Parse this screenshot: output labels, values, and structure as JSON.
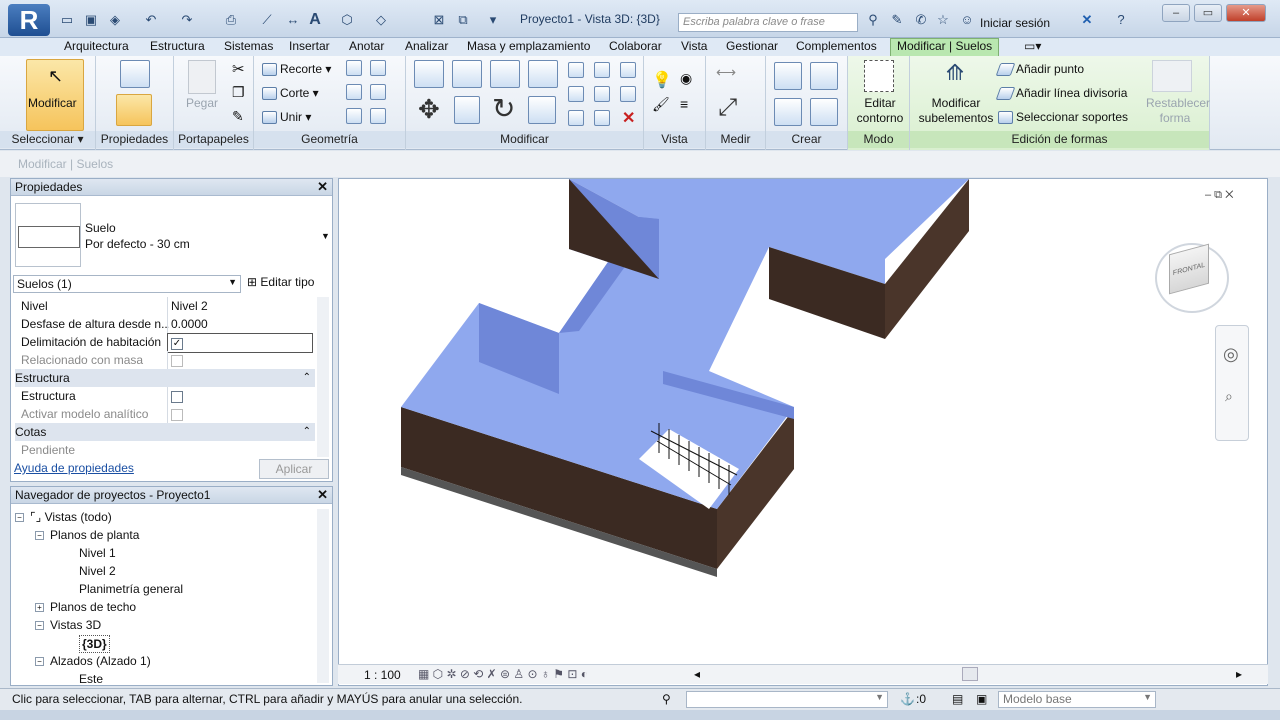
{
  "titlebar": {
    "doc_title": "Proyecto1 - Vista 3D: {3D}",
    "search_placeholder": "Escriba palabra clave o frase",
    "signin": "Iniciar sesión"
  },
  "tabs": [
    "Arquitectura",
    "Estructura",
    "Sistemas",
    "Insertar",
    "Anotar",
    "Analizar",
    "Masa y emplazamiento",
    "Colaborar",
    "Vista",
    "Gestionar",
    "Complementos",
    "Modificar | Suelos"
  ],
  "ribbon": {
    "modificar": "Modificar",
    "seleccionar": "Seleccionar",
    "propiedades": "Propiedades",
    "pegar": "Pegar",
    "portapapeles": "Portapapeles",
    "recorte": "Recorte",
    "corte": "Corte",
    "unir": "Unir",
    "geometria": "Geometría",
    "modificar_panel": "Modificar",
    "vista": "Vista",
    "medir": "Medir",
    "crear": "Crear",
    "editar_contorno": "Editar contorno",
    "modo": "Modo",
    "modificar_subelementos": "Modificar subelementos",
    "anadir_punto": "Añadir punto",
    "anadir_linea": "Añadir línea divisoria",
    "seleccionar_soportes": "Seleccionar soportes",
    "restablecer_forma": "Restablecer forma",
    "edicion_formas": "Edición de formas"
  },
  "optbar": "Modificar | Suelos",
  "properties": {
    "title": "Propiedades",
    "type_name": "Suelo",
    "type_sub": "Por defecto - 30 cm",
    "filter": "Suelos (1)",
    "edit_type": "Editar tipo",
    "rows": [
      {
        "k": "Nivel",
        "v": "Nivel 2"
      },
      {
        "k": "Desfase de altura desde n...",
        "v": "0.0000"
      },
      {
        "k": "Delimitación de habitación",
        "v": "✓"
      },
      {
        "k": "Relacionado con masa",
        "v": ""
      }
    ],
    "group_estructura": "Estructura",
    "estructura": "Estructura",
    "activar": "Activar modelo analítico",
    "group_cotas": "Cotas",
    "pendiente": "Pendiente",
    "help": "Ayuda de propiedades",
    "apply": "Aplicar"
  },
  "navigator": {
    "title": "Navegador de proyectos - Proyecto1",
    "items": [
      "Vistas (todo)",
      "Planos de planta",
      "Nivel 1",
      "Nivel 2",
      "Planimetría general",
      "Planos de techo",
      "Vistas 3D",
      "{3D}",
      "Alzados (Alzado 1)",
      "Este"
    ]
  },
  "viewport": {
    "scale": "1 : 100",
    "cube_label": "FRONTAL"
  },
  "status": {
    "hint": "Clic para seleccionar, TAB para alternar, CTRL para añadir y MAYÚS para anular una selección.",
    "count": ":0",
    "model": "Modelo base"
  }
}
